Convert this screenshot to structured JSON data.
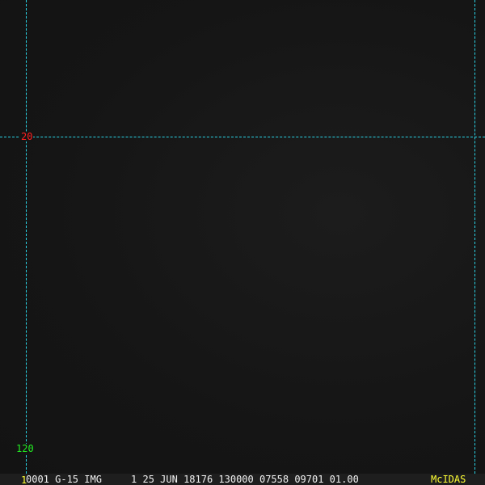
{
  "grid": {
    "lat_label": "20",
    "lon_label": "120",
    "line_color": "#2ad4e6"
  },
  "status_bar": {
    "frame_number": "1",
    "text": "0001 G-15 IMG     1 25 JUN 18176 130000 07558 09701 01.00",
    "brand": "McIDAS"
  },
  "colors": {
    "lat_label": "#ff2020",
    "lon_label": "#22ee22",
    "brand": "#ffff33"
  }
}
